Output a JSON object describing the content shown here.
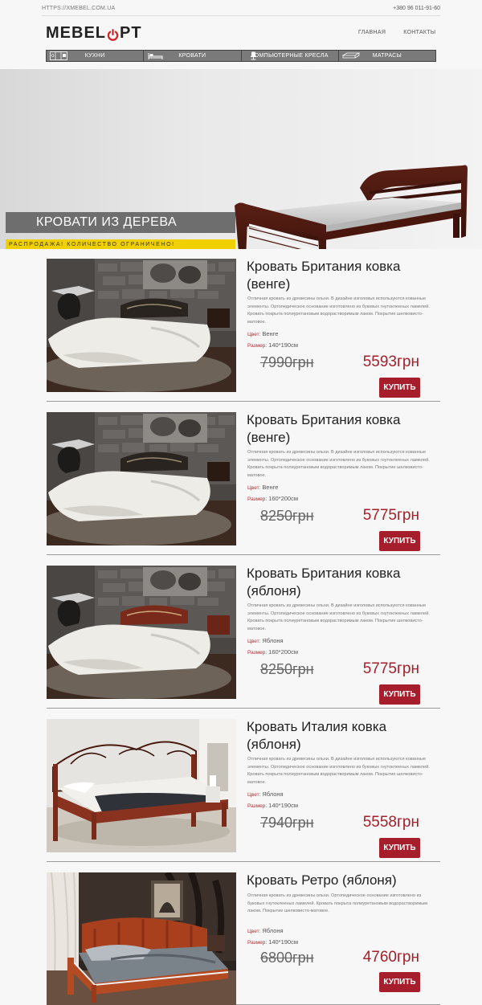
{
  "header": {
    "site_url": "HTTPS://XMEBEL.COM.UA",
    "phone": "+380 96 011-91-60",
    "logo_left": "MEBEL",
    "logo_right": "PT",
    "nav": [
      "ГЛАВНАЯ",
      "КОНТАКТЫ"
    ],
    "categories": [
      {
        "label": "КУХНИ",
        "icon": "kitchen-icon"
      },
      {
        "label": "КРОВАТИ",
        "icon": "bed-icon"
      },
      {
        "label": "КОМПЬЮТЕРНЫЕ КРЕСЛА",
        "icon": "office-chair-icon"
      },
      {
        "label": "МАТРАСЫ",
        "icon": "mattress-icon"
      }
    ]
  },
  "hero": {
    "title": "КРОВАТИ ИЗ ДЕРЕВА",
    "subtitle": "РАСПРОДАЖА! КОЛИЧЕСТВО ОГРАНИЧЕНО!"
  },
  "labels": {
    "color": "Цвет:",
    "size": "Размер:",
    "buy": "КУПИТЬ"
  },
  "colors": {
    "accent": "#a61e2b",
    "price": "#a51f29",
    "highlight": "#f0d000"
  },
  "products": [
    {
      "name": "Кровать Британия ковка (венге)",
      "description": "Отличная кровать из древесины ольхи. В дизайне изголовья используются кованные элементы. Ортопедическое основание изготовлено из буковых гнутоклееных ламелей. Кровать покрыта полиуретановым водорастворимым лаком. Покрытие шелковисто-матовое.",
      "color": "Венге",
      "size": "140*190см",
      "old_price": "7990грн",
      "new_price": "5593грн"
    },
    {
      "name": "Кровать Британия ковка (венге)",
      "description": "Отличная кровать из древесины ольхи. В дизайне изголовья используются кованные элементы. Ортопедическое основание изготовлено из буковых гнутоклееных ламелей. Кровать покрыта полиуретановым водорастворимым лаком. Покрытие шелковисто-матовое.",
      "color": "Венге",
      "size": "160*200см",
      "old_price": "8250грн",
      "new_price": "5775грн"
    },
    {
      "name": "Кровать Британия ковка (яблоня)",
      "description": "Отличная кровать из древесины ольхи. В дизайне изголовья используются кованные элементы. Ортопедическое основание изготовлено из буковых гнутоклееных ламелей. Кровать покрыта полиуретановым водорастворимым лаком. Покрытие шелковисто-матовое.",
      "color": "Яблоня",
      "size": "160*200см",
      "old_price": "8250грн",
      "new_price": "5775грн"
    },
    {
      "name": "Кровать Италия ковка (яблоня)",
      "description": "Отличная кровать из древесины ольхи. В дизайне изголовья используются кованные элементы. Ортопедическое основание изготовлено из буковых гнутоклееных ламелей. Кровать покрыта полиуретановым водорастворимым лаком. Покрытие шелковисто-матовое.",
      "color": "Яблоня",
      "size": "140*190см",
      "old_price": "7940грн",
      "new_price": "5558грн"
    },
    {
      "name": "Кровать Ретро (яблоня)",
      "description": "Отличная кровать из древесины ольхи. Ортопедическое основание изготовлено из буковых гнутоклееных ламелей. Кровать покрыта полиуретановым водорастворимым лаком. Покрытие шелковисто-матовое.",
      "color": "Яблоня",
      "size": "140*190см",
      "old_price": "6800грн",
      "new_price": "4760грн"
    }
  ]
}
